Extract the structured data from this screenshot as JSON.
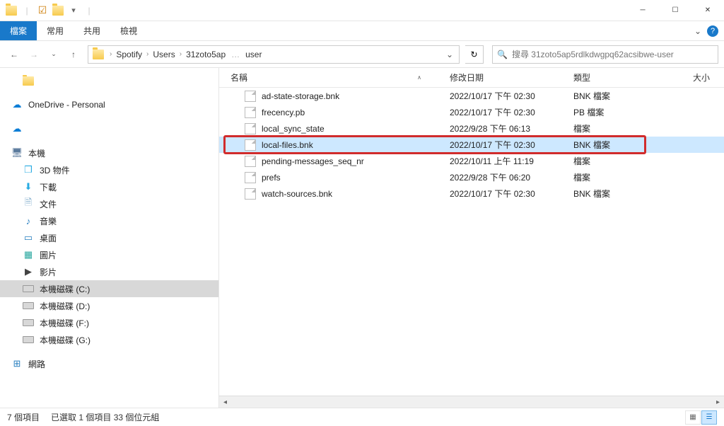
{
  "window": {
    "title": ""
  },
  "ribbon": {
    "tabs": [
      "檔案",
      "常用",
      "共用",
      "檢視"
    ],
    "chevron": "⌄"
  },
  "breadcrumbs": [
    "Spotify",
    "Users",
    "31zoto5ap",
    "user"
  ],
  "search": {
    "placeholder": "搜尋 31zoto5ap5rdlkdwgpq62acsibwe-user"
  },
  "columns": {
    "name": "名稱",
    "date": "修改日期",
    "type": "類型",
    "size": "大小"
  },
  "tree": {
    "quick": "",
    "onedrive": "OneDrive - Personal",
    "cloud2": "",
    "pc": "本機",
    "threeD": "3D 物件",
    "downloads": "下載",
    "documents": "文件",
    "music": "音樂",
    "desktop": "桌面",
    "pictures": "圖片",
    "videos": "影片",
    "driveC": "本機磁碟 (C:)",
    "driveD": "本機磁碟 (D:)",
    "driveF": "本機磁碟 (F:)",
    "driveG": "本機磁碟 (G:)",
    "network": "網路"
  },
  "files": [
    {
      "name": "ad-state-storage.bnk",
      "date": "2022/10/17 下午 02:30",
      "type": "BNK 檔案"
    },
    {
      "name": "frecency.pb",
      "date": "2022/10/17 下午 02:30",
      "type": "PB 檔案"
    },
    {
      "name": "local_sync_state",
      "date": "2022/9/28 下午 06:13",
      "type": "檔案"
    },
    {
      "name": "local-files.bnk",
      "date": "2022/10/17 下午 02:30",
      "type": "BNK 檔案",
      "selected": true,
      "highlighted": true
    },
    {
      "name": "pending-messages_seq_nr",
      "date": "2022/10/11 上午 11:19",
      "type": "檔案"
    },
    {
      "name": "prefs",
      "date": "2022/9/28 下午 06:20",
      "type": "檔案"
    },
    {
      "name": "watch-sources.bnk",
      "date": "2022/10/17 下午 02:30",
      "type": "BNK 檔案"
    }
  ],
  "status": {
    "items": "7 個項目",
    "selected": "已選取 1 個項目 33 個位元組"
  }
}
